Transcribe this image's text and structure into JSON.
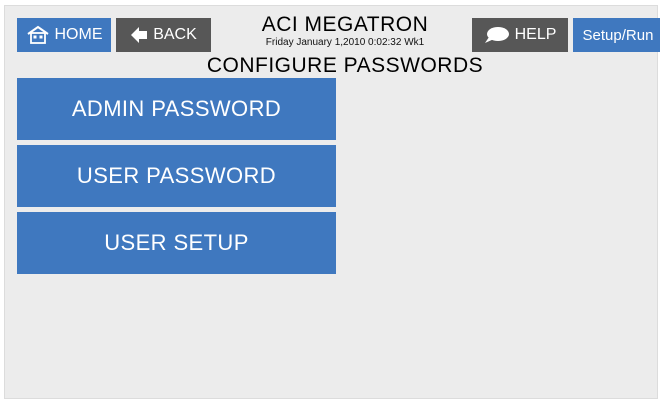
{
  "header": {
    "home_label": "HOME",
    "back_label": "BACK",
    "help_label": "HELP",
    "setup_label": "Setup/Run",
    "title": "ACI MEGATRON",
    "datetime": "Friday January 1,2010 0:02:32 Wk1",
    "subtitle": "CONFIGURE PASSWORDS"
  },
  "menu": {
    "items": [
      {
        "label": "ADMIN PASSWORD"
      },
      {
        "label": "USER PASSWORD"
      },
      {
        "label": "USER SETUP"
      }
    ]
  },
  "icons": {
    "home": "home-icon",
    "back": "back-arrow-icon",
    "help": "speech-bubble-icon"
  },
  "colors": {
    "button_blue": "#3f78bf",
    "button_gray": "#575757",
    "background": "#ececec"
  }
}
